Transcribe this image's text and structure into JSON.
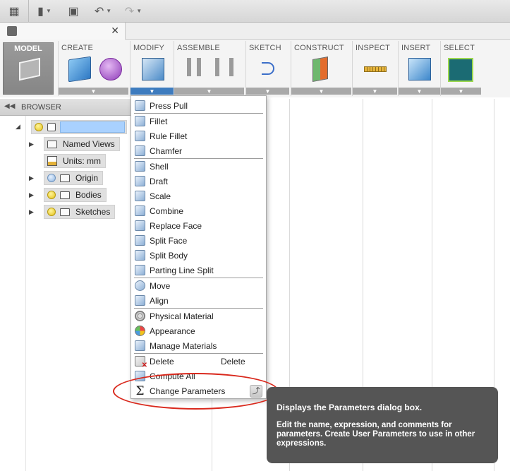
{
  "toolbar": {
    "model_label": "MODEL",
    "groups": [
      {
        "label": "CREATE"
      },
      {
        "label": "MODIFY"
      },
      {
        "label": "ASSEMBLE"
      },
      {
        "label": "SKETCH"
      },
      {
        "label": "CONSTRUCT"
      },
      {
        "label": "INSPECT"
      },
      {
        "label": "INSERT"
      },
      {
        "label": "SELECT"
      }
    ],
    "active_group": "MODIFY"
  },
  "browser": {
    "title": "BROWSER",
    "items": [
      {
        "label": "Named Views"
      },
      {
        "label": "Units: mm"
      },
      {
        "label": "Origin"
      },
      {
        "label": "Bodies"
      },
      {
        "label": "Sketches"
      }
    ]
  },
  "menu": {
    "items": [
      {
        "label": "Press Pull"
      },
      {
        "label": "Fillet"
      },
      {
        "label": "Rule Fillet"
      },
      {
        "label": "Chamfer"
      },
      {
        "label": "Shell"
      },
      {
        "label": "Draft"
      },
      {
        "label": "Scale"
      },
      {
        "label": "Combine"
      },
      {
        "label": "Replace Face"
      },
      {
        "label": "Split Face"
      },
      {
        "label": "Split Body"
      },
      {
        "label": "Parting Line Split"
      },
      {
        "label": "Move"
      },
      {
        "label": "Align"
      },
      {
        "label": "Physical Material"
      },
      {
        "label": "Appearance"
      },
      {
        "label": "Manage Materials"
      },
      {
        "label": "Delete",
        "shortcut": "Delete"
      },
      {
        "label": "Compute All"
      },
      {
        "label": "Change Parameters"
      }
    ]
  },
  "tooltip": {
    "line1": "Displays the Parameters dialog box.",
    "line2": "Edit the name, expression, and comments for parameters. Create User Parameters to use in other expressions."
  },
  "colors": {
    "accent": "#3e7cbf",
    "callout": "#d9281c",
    "tooltip_bg": "#555555"
  }
}
